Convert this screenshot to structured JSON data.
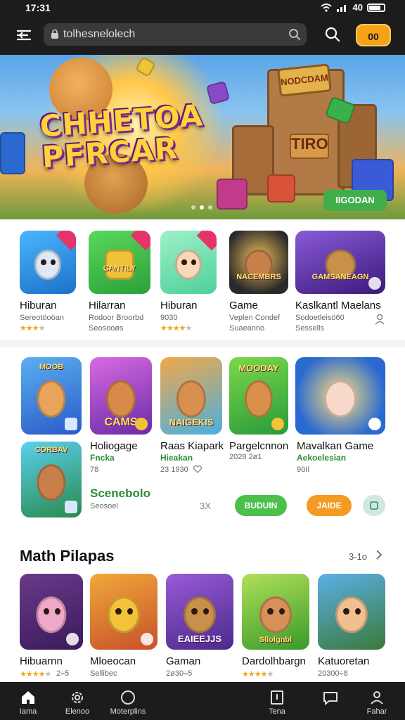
{
  "status_bar": {
    "time": "17:31",
    "signal": "▲ .│││",
    "network": "40"
  },
  "top_bar": {
    "search_value": "tolhesnelolech",
    "coin_label": "00"
  },
  "banner": {
    "title": "CHHETOA PFRCAR",
    "sign_top": "NODCDAM",
    "sign_bottom": "TIRO",
    "cta_label": "IIGODAN",
    "slides": 3,
    "active_slide": 1
  },
  "row1": {
    "apps": [
      {
        "title": "Hiburan",
        "sub1": "Sereotöoöan",
        "rating": 3,
        "sub2": "",
        "thumb_color": "#2a8ee0",
        "accent": "#4ab6ff"
      },
      {
        "title": "Hilarran",
        "sub1": "Rodoor Broorbd",
        "rating": 0,
        "sub2": "Seosooøs",
        "thumb_color": "#3cc24a",
        "accent": "#f0c23a"
      },
      {
        "title": "Hiburan",
        "sub1": "9030",
        "rating": 4,
        "sub2": "",
        "thumb_color": "#7ee0b0",
        "accent": "#f8d8a0"
      },
      {
        "title": "Game",
        "sub1": "Veplen Condef",
        "rating": 0,
        "sub2": "Suaeanno",
        "thumb_color": "#2a2a2a",
        "accent": "#e05a2a"
      },
      {
        "title": "Kaslkantl Maelans",
        "sub1": "Sodoetleisö60",
        "rating": 0,
        "sub2": "Sessells",
        "thumb_color": "#6a3ab0",
        "accent": "#ffcf3a"
      }
    ],
    "thumb_labels": [
      "",
      "CANTILY",
      "",
      "NACEMBRS",
      "GAMSANEAGN"
    ]
  },
  "row2": {
    "apps": [
      {
        "title": "",
        "thumb_color": "#3a7ad8",
        "label": "MOOB"
      },
      {
        "title": "",
        "thumb_color": "#a84ac8",
        "label": "CAMS"
      },
      {
        "title": "",
        "thumb_color": "#4aa0d8",
        "label": "NAIGEKIS"
      },
      {
        "title": "",
        "thumb_color": "#4ac040",
        "label": "MOODAY"
      },
      {
        "title": "",
        "thumb_color": "#2a6ad0",
        "label": ""
      },
      {
        "title": "",
        "thumb_color": "#3aa050",
        "label": "CORBAV"
      }
    ],
    "captions": [
      {
        "title": "Holiogage",
        "sub": "Fncka",
        "meta": "78"
      },
      {
        "title": "Raas Kiapark",
        "sub": "Hieakan",
        "meta": "23 1930"
      },
      {
        "title": "Pargelcnnon",
        "sub": "",
        "meta": "2028 2ø1"
      },
      {
        "title": "Mavalkan Game",
        "sub": "Aekoelesian",
        "meta": "9öIí"
      }
    ],
    "featured": {
      "title": "Scenebolo",
      "sub": "Seosoel",
      "count": "3X"
    },
    "buttons": {
      "green": "BUDUIN",
      "orange": "JAIDE"
    }
  },
  "row3": {
    "section_title": "Math Pilapas",
    "see_all": "3-1o",
    "apps": [
      {
        "title": "Hibuarnn",
        "rating": 4,
        "meta": "2÷5",
        "thumb_color": "#5a2a6a",
        "accent": "#f0a8c8"
      },
      {
        "title": "Mloeocan",
        "rating": 0,
        "meta": "Sellibec",
        "thumb_color": "#e07a2a",
        "accent": "#f2c23a"
      },
      {
        "title": "Gaman",
        "rating": 0,
        "meta": "2ø30÷5",
        "thumb_color": "#7a3ab0",
        "accent": "#d8a060",
        "label": "EAIEEJJS"
      },
      {
        "title": "Dardolhbargn",
        "rating": 4,
        "meta": "",
        "thumb_color": "#6ab030",
        "accent": "#e8b080",
        "label": "Sllolgnbl"
      },
      {
        "title": "Katuoretan",
        "rating": 0,
        "meta": "20300÷8",
        "thumb_color": "#3a8ac0",
        "accent": "#f0c090"
      }
    ]
  },
  "bottom_nav": [
    {
      "label": "Iama",
      "icon": "home-icon"
    },
    {
      "label": "Elenoo",
      "icon": "gear-icon"
    },
    {
      "label": "Moterplins",
      "icon": "circle-icon"
    },
    {
      "label": "Tena",
      "icon": "tablet-icon"
    },
    {
      "label": "",
      "icon": "chat-icon"
    },
    {
      "label": "Fahar",
      "icon": "profile-icon"
    }
  ],
  "colors": {
    "bar_bg": "#1c1c1c",
    "green": "#3fae4b",
    "orange": "#f5a21b",
    "star": "#f2a516"
  }
}
